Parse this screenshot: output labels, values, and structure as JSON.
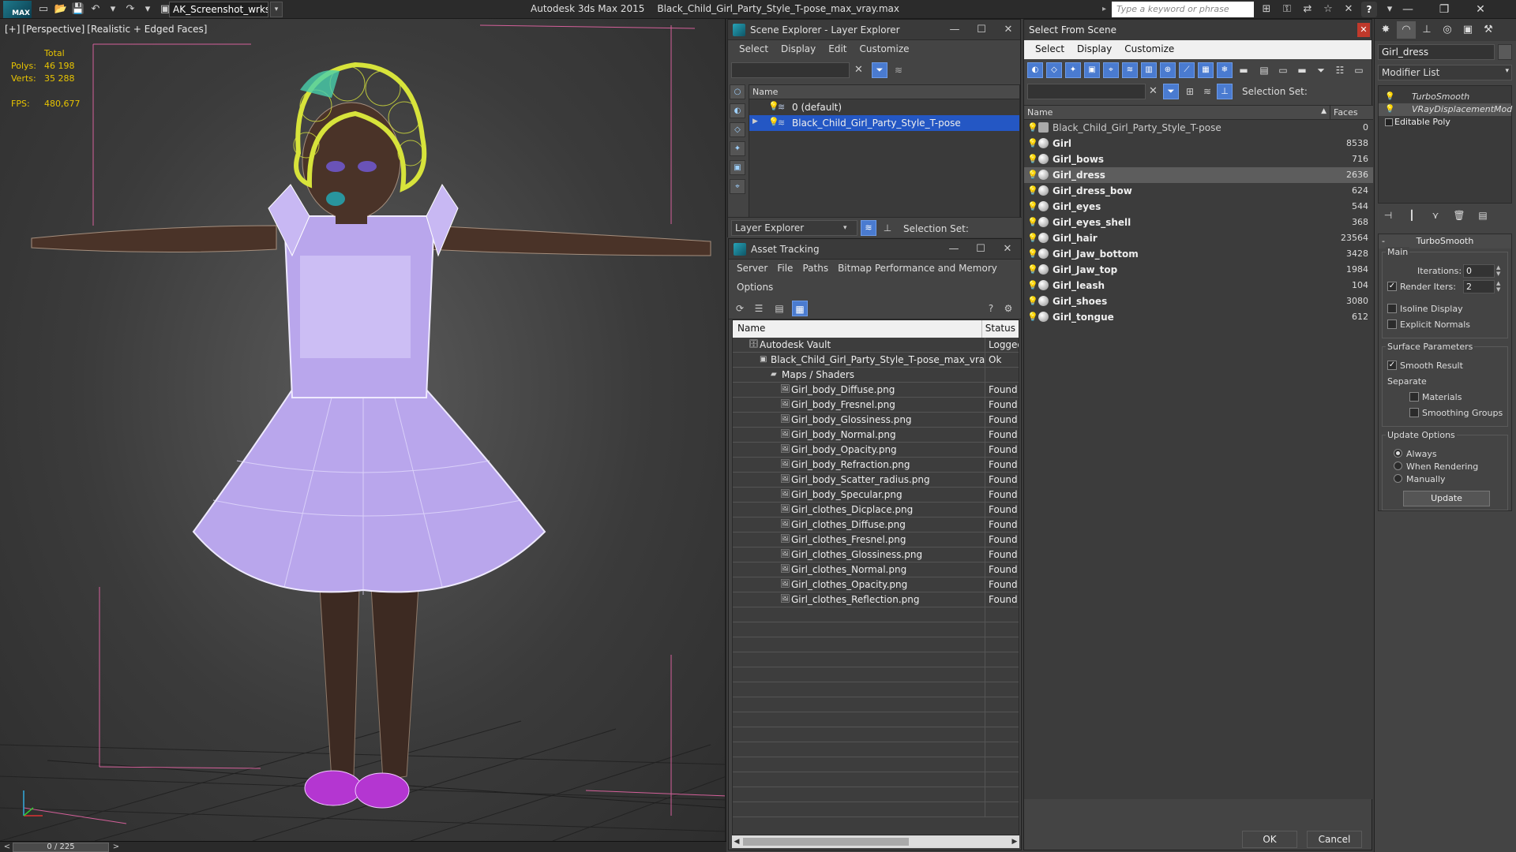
{
  "titlebar": {
    "workspace": "AK_Screenshot_wrksp",
    "app_name": "Autodesk 3ds Max  2015",
    "file_name": "Black_Child_Girl_Party_Style_T-pose_max_vray.max",
    "search_placeholder": "Type a keyword or phrase",
    "logo_text": "MAX"
  },
  "viewport": {
    "labels": [
      "[+]",
      "[Perspective]",
      "[Realistic + Edged Faces]"
    ],
    "stats": {
      "header": "Total",
      "polys_label": "Polys:",
      "polys_value": "46 198",
      "verts_label": "Verts:",
      "verts_value": "35 288",
      "fps_label": "FPS:",
      "fps_value": "480,677"
    },
    "colors": {
      "skin": "#4a3328",
      "dress": "#b9a6ec",
      "hair": "#d7e33b",
      "shoes": "#b436d1"
    }
  },
  "timeslider": {
    "label": "0 / 225",
    "prev": "<",
    "next": ">"
  },
  "scene_explorer": {
    "title": "Scene Explorer - Layer Explorer",
    "menu": [
      "Select",
      "Display",
      "Edit",
      "Customize"
    ],
    "column": "Name",
    "rows": [
      {
        "name": "0 (default)",
        "selected": false
      },
      {
        "name": "Black_Child_Girl_Party_Style_T-pose",
        "selected": true
      }
    ],
    "layer_dropdown": "Layer Explorer",
    "selection_set": "Selection Set:"
  },
  "asset_tracking": {
    "title": "Asset Tracking",
    "menu": [
      "Server",
      "File",
      "Paths",
      "Bitmap Performance and Memory",
      "Options"
    ],
    "columns": {
      "name": "Name",
      "status": "Status"
    },
    "rows": [
      {
        "name": "Autodesk Vault",
        "status": "Logged",
        "level": 1
      },
      {
        "name": "Black_Child_Girl_Party_Style_T-pose_max_vray....",
        "status": "Ok",
        "level": 2
      },
      {
        "name": "Maps / Shaders",
        "status": "",
        "level": 3
      },
      {
        "name": "Girl_body_Diffuse.png",
        "status": "Found",
        "level": 4
      },
      {
        "name": "Girl_body_Fresnel.png",
        "status": "Found",
        "level": 4
      },
      {
        "name": "Girl_body_Glossiness.png",
        "status": "Found",
        "level": 4
      },
      {
        "name": "Girl_body_Normal.png",
        "status": "Found",
        "level": 4
      },
      {
        "name": "Girl_body_Opacity.png",
        "status": "Found",
        "level": 4
      },
      {
        "name": "Girl_body_Refraction.png",
        "status": "Found",
        "level": 4
      },
      {
        "name": "Girl_body_Scatter_radius.png",
        "status": "Found",
        "level": 4
      },
      {
        "name": "Girl_body_Specular.png",
        "status": "Found",
        "level": 4
      },
      {
        "name": "Girl_clothes_Dicplace.png",
        "status": "Found",
        "level": 4
      },
      {
        "name": "Girl_clothes_Diffuse.png",
        "status": "Found",
        "level": 4
      },
      {
        "name": "Girl_clothes_Fresnel.png",
        "status": "Found",
        "level": 4
      },
      {
        "name": "Girl_clothes_Glossiness.png",
        "status": "Found",
        "level": 4
      },
      {
        "name": "Girl_clothes_Normal.png",
        "status": "Found",
        "level": 4
      },
      {
        "name": "Girl_clothes_Opacity.png",
        "status": "Found",
        "level": 4
      },
      {
        "name": "Girl_clothes_Reflection.png",
        "status": "Found",
        "level": 4
      }
    ]
  },
  "select_from_scene": {
    "title": "Select From Scene",
    "menu": [
      "Select",
      "Display",
      "Customize"
    ],
    "selection_set": "Selection Set:",
    "columns": {
      "name": "Name",
      "faces": "Faces"
    },
    "rows": [
      {
        "name": "Black_Child_Girl_Party_Style_T-pose",
        "faces": "0",
        "group": true,
        "selected": false
      },
      {
        "name": "Girl",
        "faces": "8538",
        "group": false,
        "selected": false
      },
      {
        "name": "Girl_bows",
        "faces": "716",
        "group": false,
        "selected": false
      },
      {
        "name": "Girl_dress",
        "faces": "2636",
        "group": false,
        "selected": true
      },
      {
        "name": "Girl_dress_bow",
        "faces": "624",
        "group": false,
        "selected": false
      },
      {
        "name": "Girl_eyes",
        "faces": "544",
        "group": false,
        "selected": false
      },
      {
        "name": "Girl_eyes_shell",
        "faces": "368",
        "group": false,
        "selected": false
      },
      {
        "name": "Girl_hair",
        "faces": "23564",
        "group": false,
        "selected": false
      },
      {
        "name": "Girl_Jaw_bottom",
        "faces": "3428",
        "group": false,
        "selected": false
      },
      {
        "name": "Girl_Jaw_top",
        "faces": "1984",
        "group": false,
        "selected": false
      },
      {
        "name": "Girl_leash",
        "faces": "104",
        "group": false,
        "selected": false
      },
      {
        "name": "Girl_shoes",
        "faces": "3080",
        "group": false,
        "selected": false
      },
      {
        "name": "Girl_tongue",
        "faces": "612",
        "group": false,
        "selected": false
      }
    ],
    "ok_label": "OK",
    "cancel_label": "Cancel"
  },
  "command_panel": {
    "object_name": "Girl_dress",
    "modifier_list": "Modifier List",
    "stack": [
      "TurboSmooth",
      "VRayDisplacementMod",
      "Editable Poly"
    ],
    "rollout_title": "TurboSmooth",
    "main_group": "Main",
    "iterations_label": "Iterations:",
    "iterations_value": "0",
    "render_iters_label": "Render Iters:",
    "render_iters_value": "2",
    "isoline_label": "Isoline Display",
    "explicit_normals_label": "Explicit Normals",
    "surface_group": "Surface Parameters",
    "smooth_result_label": "Smooth Result",
    "separate_label": "Separate",
    "materials_label": "Materials",
    "smoothing_groups_label": "Smoothing Groups",
    "update_group": "Update Options",
    "always_label": "Always",
    "when_rendering_label": "When Rendering",
    "manually_label": "Manually",
    "update_button": "Update"
  }
}
